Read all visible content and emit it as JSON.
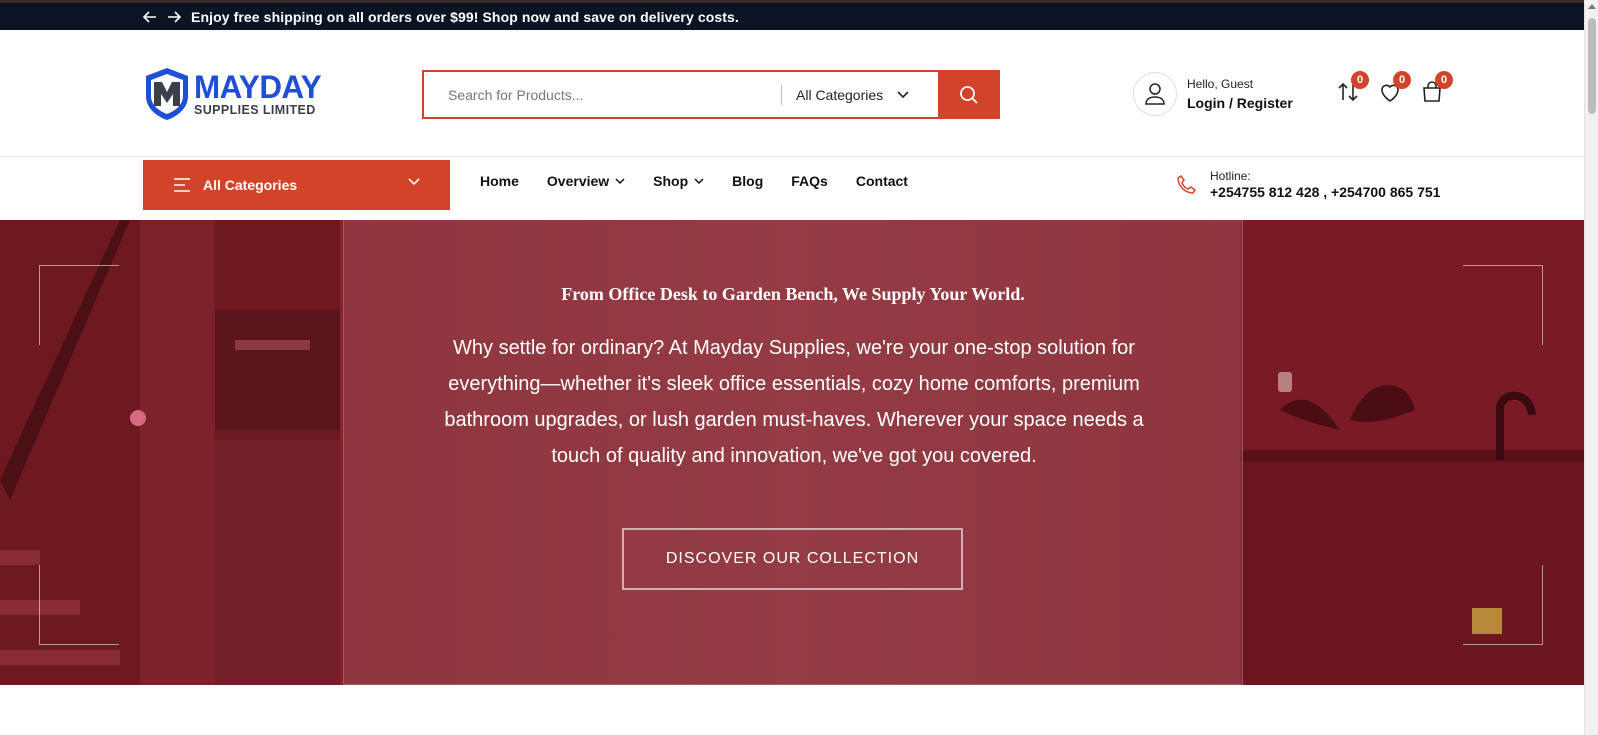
{
  "topbar": {
    "promo": "Enjoy free shipping on all orders over $99! Shop now and save on delivery costs."
  },
  "logo": {
    "title": "MAYDAY",
    "subtitle": "SUPPLIES LIMITED",
    "brand_color": "#1f4fd6"
  },
  "search": {
    "placeholder": "Search for Products...",
    "category": "All Categories"
  },
  "account": {
    "greeting": "Hello, Guest",
    "action": "Login / Register"
  },
  "header_icons": {
    "compare_count": "0",
    "wishlist_count": "0",
    "cart_count": "0"
  },
  "nav": {
    "all_categories": "All Categories",
    "items": [
      "Home",
      "Overview",
      "Shop",
      "Blog",
      "FAQs",
      "Contact"
    ],
    "hotline_label": "Hotline:",
    "hotline_numbers": "+254755 812 428 , +254700 865 751"
  },
  "hero": {
    "tagline": "From Office Desk to Garden Bench, We Supply Your World.",
    "description": "Why settle for ordinary? At Mayday Supplies, we're your one-stop solution for everything—whether it's sleek office essentials, cozy home comforts, premium bathroom upgrades, or lush garden must-haves. Wherever your space needs a touch of quality and innovation, we've got you covered.",
    "cta": "DISCOVER OUR COLLECTION"
  },
  "colors": {
    "accent": "#d2432a",
    "topbar": "#0b1423",
    "hero": "#8a2630"
  }
}
